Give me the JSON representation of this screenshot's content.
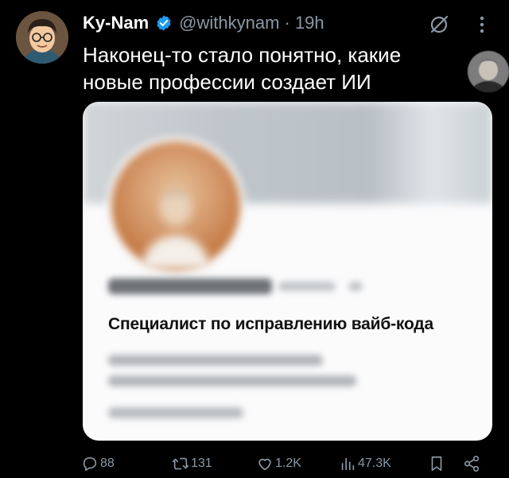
{
  "tweet": {
    "author_name": "Ky-Nam",
    "handle_time": "@withkynam · 19h",
    "text_line1": "Наконец-то стало понятно, какие",
    "text_line2": "новые профессии создает ИИ"
  },
  "card": {
    "title": "Специалист по исправлению вайб-кода"
  },
  "actions": {
    "replies": "88",
    "reposts": "131",
    "likes": "1.2K",
    "views": "47.3K"
  },
  "colors": {
    "background": "#000000",
    "text": "#e7e9ea",
    "muted": "#8b98a5",
    "verified": "#1d9bf0",
    "card_background": "#fbfbfc"
  },
  "icons": [
    "verified-badge-icon",
    "grok-icon",
    "more-icon",
    "reply-icon",
    "repost-icon",
    "like-icon",
    "views-icon",
    "bookmark-icon",
    "share-icon"
  ]
}
